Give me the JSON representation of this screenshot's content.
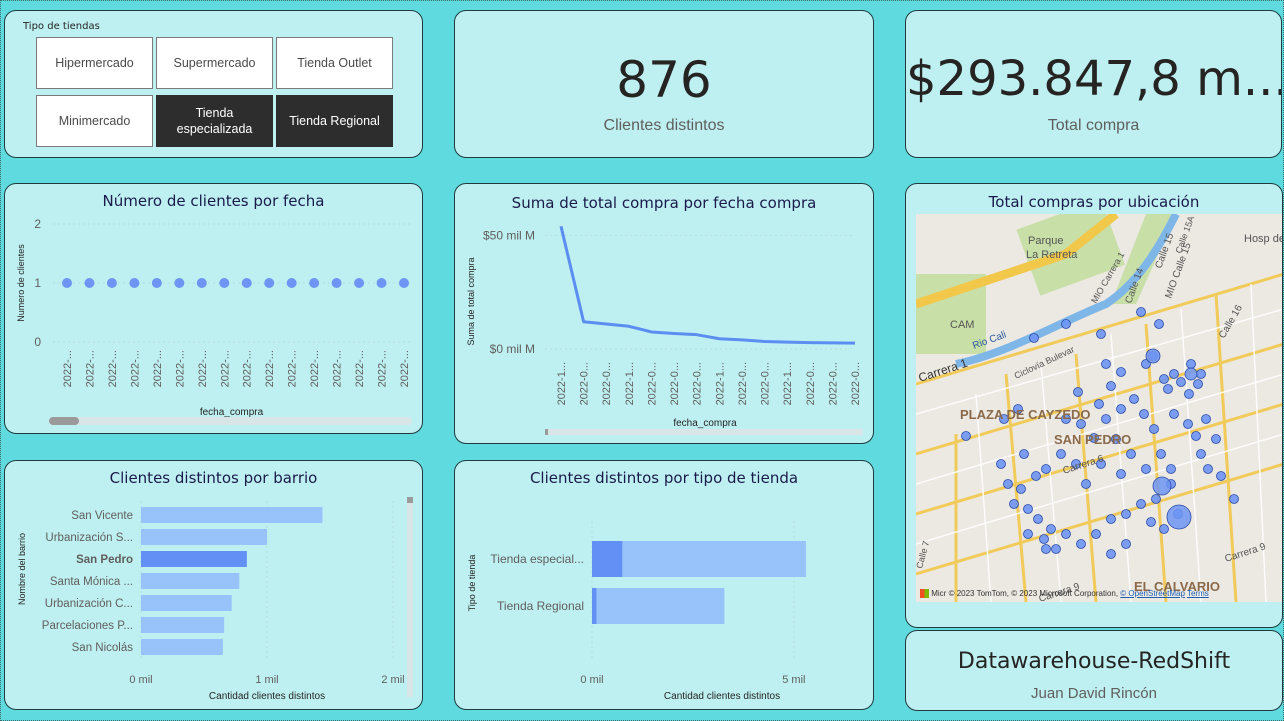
{
  "slicer": {
    "title": "Tipo de tiendas",
    "options": [
      {
        "label": "Hipermercado",
        "selected": false
      },
      {
        "label": "Supermercado",
        "selected": false
      },
      {
        "label": "Tienda Outlet",
        "selected": false
      },
      {
        "label": "Minimercado",
        "selected": false
      },
      {
        "label": "Tienda especializada",
        "selected": true
      },
      {
        "label": "Tienda Regional",
        "selected": true
      }
    ]
  },
  "kpi_clients": {
    "value": "876",
    "label": "Clientes distintos"
  },
  "kpi_total": {
    "value": "$293.847,8 m...",
    "label": "Total compra"
  },
  "map": {
    "title": "Total compras por ubicación",
    "labels": {
      "parque": "Parque",
      "la_retreta": "La Retreta",
      "cam": "CAM",
      "plaza": "PLAZA DE CAYZEDO",
      "san_pedro": "SAN PEDRO",
      "calvario": "EL CALVARIO",
      "rio_cali": "Rio Cali",
      "carrera1": "Carrera 1",
      "carrera6": "Carrera 6",
      "carrera9a": "Carrera 9",
      "carrera9b": "Carrera 9",
      "calle15": "Calle 15",
      "calle16": "Calle 16",
      "calle14": "Calle 14",
      "mio1": "MIO Carrera 1",
      "mio2": "MIO Calle 15",
      "hosp": "Hosp de S Juan cal",
      "ciclovia": "Ciclovía Bulevar",
      "calle7": "Calle 7",
      "calle15a": "Calle 15A"
    },
    "attribution": "© 2023 TomTom, © 2023 Microsoft Corporation, ",
    "attribution_link1": "© OpenStreetMap",
    "attribution_link2": "Terms",
    "brand": "Micr"
  },
  "footer": {
    "title": "Datawarehouse-RedShift",
    "author": "Juan David Rincón"
  },
  "chart_data": [
    {
      "id": "clientes_fecha",
      "type": "scatter",
      "title": "Número de clientes por fecha",
      "xlabel": "fecha_compra",
      "ylabel": "Numero de clientes",
      "yticks": [
        0,
        1,
        2
      ],
      "ylim": [
        0,
        2
      ],
      "x": [
        "2022-...",
        "2022-...",
        "2022-...",
        "2022-...",
        "2022-...",
        "2022-...",
        "2022-...",
        "2022-...",
        "2022-...",
        "2022-...",
        "2022-...",
        "2022-...",
        "2022-...",
        "2022-...",
        "2022-...",
        "2022-..."
      ],
      "values": [
        1,
        1,
        1,
        1,
        1,
        1,
        1,
        1,
        1,
        1,
        1,
        1,
        1,
        1,
        1,
        1
      ],
      "color": "#6e95f3"
    },
    {
      "id": "total_compra_fecha",
      "type": "line",
      "title": "Suma de total compra por fecha compra",
      "xlabel": "fecha_compra",
      "ylabel": "Suma de total compra",
      "ytick_labels": [
        "$50 mil M",
        "$0 mil M"
      ],
      "yticks": [
        50,
        0
      ],
      "ylim": [
        0,
        55
      ],
      "x": [
        "2022-1...",
        "2022-0...",
        "2022-0...",
        "2022-1...",
        "2022-0...",
        "2022-0...",
        "2022-0...",
        "2022-1...",
        "2022-0...",
        "2022-0...",
        "2022-1...",
        "2022-0...",
        "2022-0...",
        "2022-0..."
      ],
      "values": [
        54,
        12,
        11,
        10,
        7.5,
        6.8,
        6.3,
        4.5,
        4.0,
        3.3,
        3.0,
        2.8,
        2.7,
        2.6
      ],
      "color": "#5b8ef0"
    },
    {
      "id": "clientes_barrio",
      "type": "bar",
      "title": "Clientes distintos por barrio",
      "xlabel": "Cantidad clientes distintos",
      "ylabel": "Nombre del barrio",
      "xtick_labels": [
        "0 mil",
        "1 mil",
        "2 mil"
      ],
      "xticks": [
        0,
        1000,
        2000
      ],
      "xlim": [
        0,
        2000
      ],
      "categories": [
        "San Vicente",
        "Urbanización S...",
        "San Pedro",
        "Santa Mónica ...",
        "Urbanización C...",
        "Parcelaciones P...",
        "San Nicolás"
      ],
      "values": [
        1440,
        1000,
        840,
        780,
        720,
        660,
        650
      ],
      "highlight": "San Pedro",
      "color": "#98c3fa",
      "highlight_color": "#6290f5"
    },
    {
      "id": "clientes_tipo_tienda",
      "type": "bar",
      "title": "Clientes distintos por tipo de tienda",
      "xlabel": "Cantidad clientes distintos",
      "ylabel": "Tipo de tienda",
      "xtick_labels": [
        "0 mil",
        "5 mil"
      ],
      "xticks": [
        0,
        5000
      ],
      "xlim": [
        0,
        5400
      ],
      "categories": [
        "Tienda especial...",
        "Tienda Regional"
      ],
      "series": [
        {
          "name": "",
          "values": [
            750,
            110
          ],
          "color": "#6290f5"
        },
        {
          "name": "",
          "values": [
            5300,
            3280
          ],
          "color": "#98c3fa"
        }
      ]
    }
  ]
}
